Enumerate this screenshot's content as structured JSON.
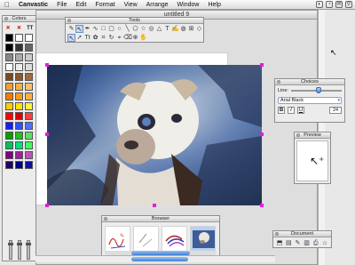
{
  "menubar": {
    "apple_icon": "apple-icon",
    "items": [
      "Canvastic",
      "File",
      "Edit",
      "Format",
      "View",
      "Arrange",
      "Window",
      "Help"
    ]
  },
  "document": {
    "title": "untitled 9"
  },
  "palettes": {
    "tools_title": "Tools",
    "colors_title": "Colors",
    "choices_title": "Choices",
    "preview_title": "Preview",
    "browser_title": "Browser",
    "document_title": "Document"
  },
  "tools": {
    "row1": [
      "pencil-tool",
      "arrow-tool",
      "pen-tool",
      "bezier-tool",
      "rect-tool",
      "rounded-rect-tool",
      "oval-tool",
      "line-tool",
      "polygon-tool",
      "star-tool",
      "spiral-tool",
      "triangle-tool",
      "text-tool",
      "freehand-tool",
      "fill-tool",
      "group-tool",
      "shape-tool"
    ],
    "row2": [
      "pointer-tool",
      "arrow-select-tool",
      "text-tool-tt",
      "stamp-tool",
      "crop-tool",
      "rotate-tool",
      "eyedropper-tool",
      "eraser-tool",
      "magnify-tool",
      "hand-tool"
    ]
  },
  "colors": {
    "swatches": [
      "#000000",
      "#ffffff",
      "#ffffff",
      "#000000",
      "#333333",
      "#666666",
      "#888888",
      "#aaaaaa",
      "#cccccc",
      "#ffffff",
      "#eeeeee",
      "#dddddd",
      "#7a4a1e",
      "#8a5a2a",
      "#a06a3a",
      "#f0a030",
      "#f5b040",
      "#f7c070",
      "#ff7a00",
      "#ff9a20",
      "#ffb040",
      "#ffcc00",
      "#ffe000",
      "#fff040",
      "#ff0000",
      "#e00000",
      "#ff4040",
      "#1a1aff",
      "#3050ff",
      "#5070ff",
      "#00a000",
      "#20c020",
      "#60e060",
      "#00c060",
      "#00e080",
      "#40ff60",
      "#800080",
      "#a020a0",
      "#c050c0",
      "#200060",
      "#000080",
      "#1010a0"
    ]
  },
  "choices": {
    "line_label": "Line:",
    "font": "Arial Black",
    "style_buttons": [
      "B",
      "I",
      "U"
    ],
    "font_size": "24"
  },
  "symbols": {
    "tool_row1": [
      "✎",
      "↖",
      "✒",
      "∿",
      "□",
      "▢",
      "○",
      "╲",
      "⬠",
      "☆",
      "◎",
      "△",
      "T",
      "✍",
      "◍",
      "⊞",
      "◇"
    ],
    "tool_row2": [
      "↖",
      "➚",
      "Tt",
      "✿",
      "⌗",
      "↻",
      "⌖",
      "⌫",
      "⊕",
      "✋"
    ],
    "color_tools": [
      "✕",
      "✕",
      "TT"
    ],
    "preview_cursor": "↖⁺",
    "desktop_cursor": "↖",
    "doc_icons": [
      "⬒",
      "▤",
      "✎",
      "▥",
      "⎙",
      "⌂"
    ],
    "tray_icons": [
      "◐",
      "◔",
      "✉",
      "⚲"
    ]
  }
}
